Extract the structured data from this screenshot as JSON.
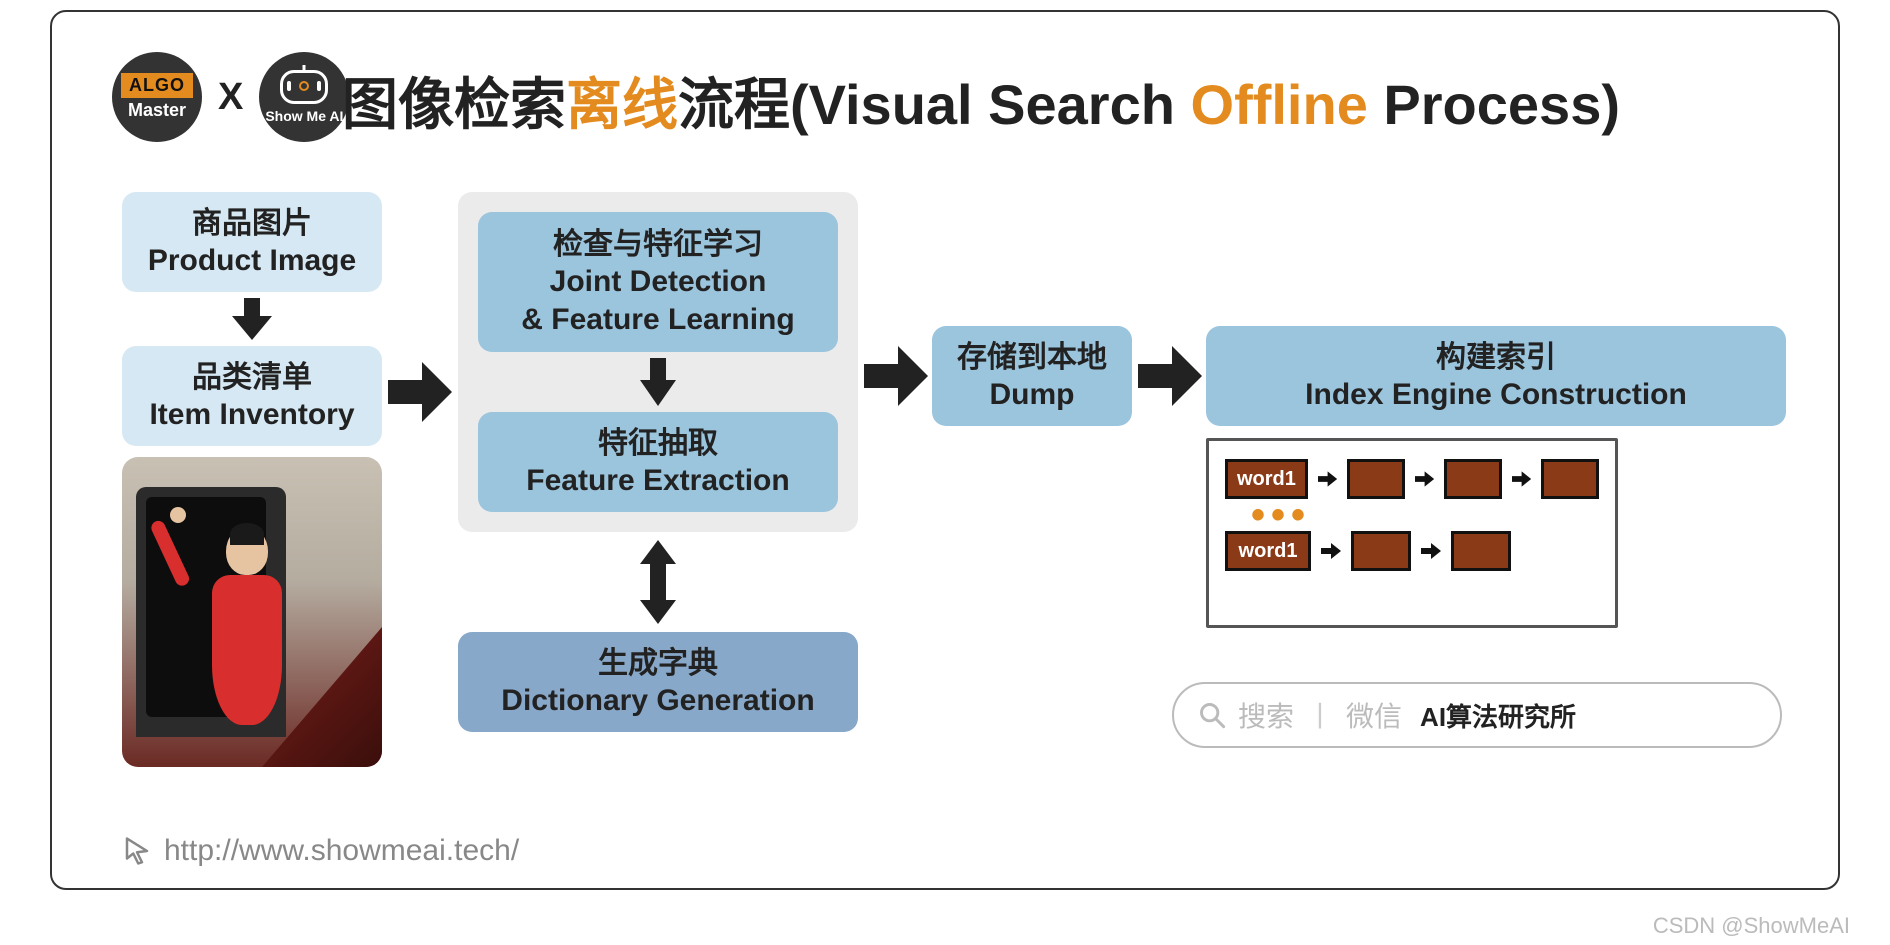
{
  "logo": {
    "algo": "ALGO",
    "master": "Master",
    "x": "X",
    "showme": "Show Me AI"
  },
  "title": {
    "cn_pre": "图像检索",
    "cn_hl": "离线",
    "cn_post": "流程",
    "en_pre": "(Visual Search ",
    "en_hl": "Offline",
    "en_post": " Process)"
  },
  "blocks": {
    "product_image": {
      "cn": "商品图片",
      "en": "Product Image"
    },
    "item_inventory": {
      "cn": "品类清单",
      "en": "Item Inventory"
    },
    "joint": {
      "cn": "检查与特征学习",
      "en1": "Joint Detection",
      "en2": "& Feature Learning"
    },
    "feature": {
      "cn": "特征抽取",
      "en": "Feature Extraction"
    },
    "dict": {
      "cn": "生成字典",
      "en": "Dictionary Generation"
    },
    "dump": {
      "cn": "存储到本地",
      "en": "Dump"
    },
    "index": {
      "cn": "构建索引",
      "en": "Index Engine Construction"
    }
  },
  "index_words": {
    "row1": "word1",
    "row2": "word1"
  },
  "search": {
    "label": "搜索",
    "wechat": "微信",
    "org": "AI算法研究所"
  },
  "footer_url": "http://www.showmeai.tech/",
  "watermark": "CSDN @ShowMeAI",
  "colors": {
    "accent": "#e38b1e",
    "block_light": "#d6e8f3",
    "block_mid": "#9bc4dd",
    "block_dark": "#88a8c9",
    "index_cell": "#8a3a17"
  }
}
